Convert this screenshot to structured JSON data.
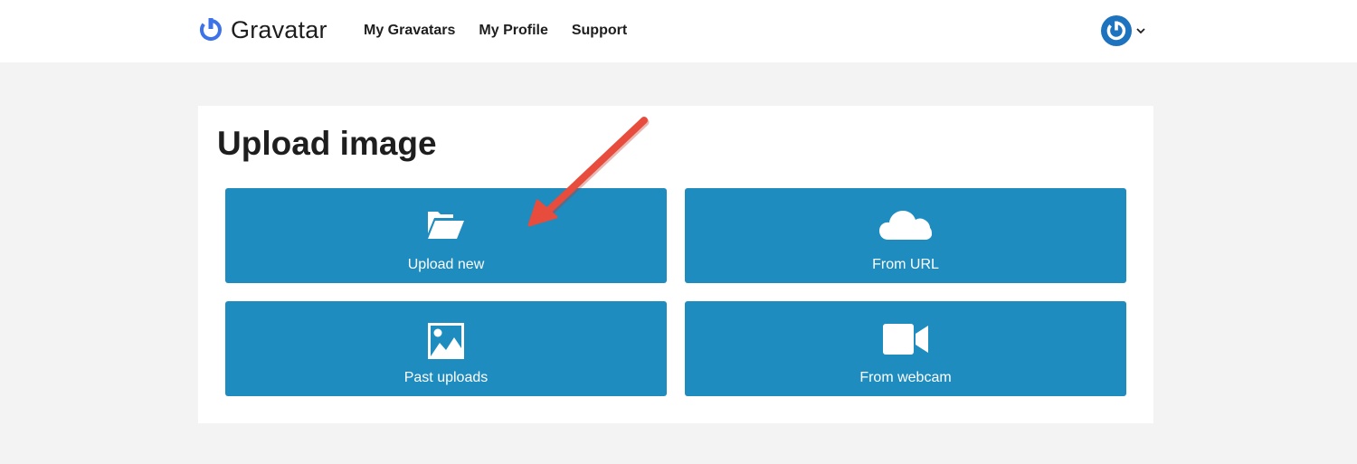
{
  "brand": {
    "name": "Gravatar",
    "logo_icon": "gravatar-power-icon",
    "color": "#3d73e8"
  },
  "nav": {
    "items": [
      {
        "label": "My Gravatars"
      },
      {
        "label": "My Profile"
      },
      {
        "label": "Support"
      }
    ]
  },
  "account": {
    "avatar_icon": "gravatar-avatar-icon",
    "menu_icon": "chevron-down-icon",
    "color": "#1e73be"
  },
  "page": {
    "title": "Upload image",
    "tiles": [
      {
        "label": "Upload new",
        "icon": "folder-open-icon"
      },
      {
        "label": "From URL",
        "icon": "cloud-icon"
      },
      {
        "label": "Past uploads",
        "icon": "image-icon"
      },
      {
        "label": "From webcam",
        "icon": "video-camera-icon"
      }
    ]
  },
  "colors": {
    "tile": "#1e8cbe",
    "background": "#f3f3f3",
    "annotation_arrow": "#e74c3c"
  }
}
